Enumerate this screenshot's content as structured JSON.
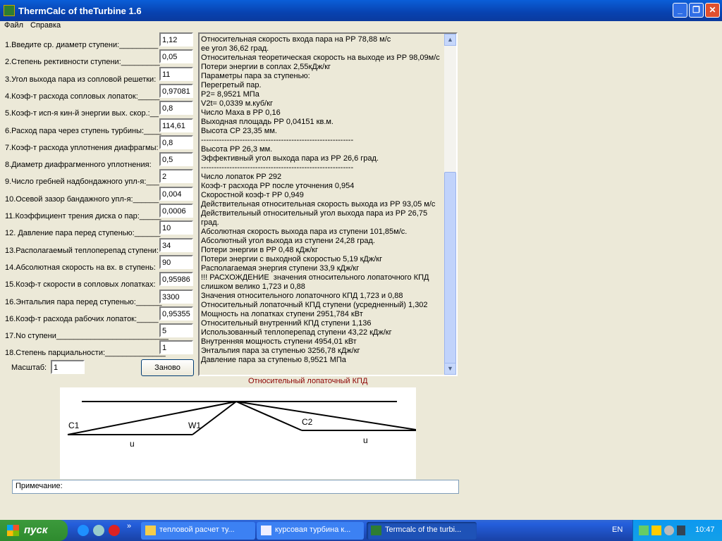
{
  "window": {
    "title": "ThermCalc of theTurbine 1.6",
    "minimize": "_",
    "maximize": "❐",
    "close": "✕"
  },
  "menu": [
    "Файл",
    "Справка"
  ],
  "fields": [
    {
      "label": "1.Введите ср. диаметр ступени:_________",
      "value": "1,12"
    },
    {
      "label": "2.Степень рективности ступени:_________",
      "value": "0,05"
    },
    {
      "label": "3.Угол выхода пара из сопловой решетки:",
      "value": "11"
    },
    {
      "label": "4.Коэф-т расхода сопловых лопаток:_____",
      "value": "0,97081"
    },
    {
      "label": "5.Коэф-т исп-я кин-й энергии вых. скор.:__",
      "value": "0,8"
    },
    {
      "label": "6.Расход пара через ступень турбины:____",
      "value": "114,61"
    },
    {
      "label": "7.Коэф-т расхода уплотнения диафрагмы:",
      "value": "0,8"
    },
    {
      "label": "8.Диаметр диафрагменного уплотнения:",
      "value": "0,5"
    },
    {
      "label": "9.Число гребней надбондажного упл-я:___",
      "value": "2"
    },
    {
      "label": "10.Осевой зазор бандажного упл-я:______",
      "value": "0,004"
    },
    {
      "label": "11.Коэффициент трения диска о пар:_____",
      "value": "0,0006"
    },
    {
      "label": "12. Давление пара перед ступенью:______",
      "value": "10"
    },
    {
      "label": "13.Располагаемый теплоперепад ступени:",
      "value": "34"
    },
    {
      "label": "14.Абсолютная скорость на вх. в ступень:",
      "value": "90"
    },
    {
      "label": "15.Коэф-т скорости в сопловых лопатках:",
      "value": "0,95986"
    },
    {
      "label": "16.Энтальпия пара перед ступенью:______",
      "value": "3300"
    },
    {
      "label": "16.Коэф-т расхода рабочих лопаток:_____",
      "value": "0,95355"
    },
    {
      "label": "17.No ступени__________________________",
      "value": "5"
    },
    {
      "label": "18.Степень парциальности:______________",
      "value": "1"
    }
  ],
  "scale": {
    "label": "Масштаб:",
    "value": "1"
  },
  "reset_button": "Заново",
  "output_lines": [
    "Относительная скорость входа пара на РР 78,88 м/с",
    "ее угол 36,62 град.",
    "Относительная теоретическая скорость на выходе из РР 98,09м/с",
    "Потери энергии в соплах 2,55кДж/кг",
    "Параметры пара за ступенью:",
    "Перегретый пар.",
    "P2= 8,9521 МПа",
    "V2t= 0,0339 м.куб/кг",
    "Число Маха в РР 0,16",
    "Выходная площадь РР 0,04151 кв.м.",
    "Высота СР 23,35 мм.",
    "-----------------------------------------------------------",
    "Высота РР 26,3 мм.",
    "Эффективный угол выхода пара из РР 26,6 град.",
    "-----------------------------------------------------------",
    "Число лопаток РР 292",
    "Коэф-т расхода РР после уточнения 0,954",
    "Скоростной коэф-т РР 0,949",
    "Действительная относительная скорость выхода из РР 93,05 м/с",
    "Действительный относительный угол выхода пара из РР 26,75 град.",
    "Абсолютная скорость выхода пара из ступени 101,85м/с.",
    "Абсолютный угол выхода из ступени 24,28 град.",
    "Потери энергии в РР 0,48 кДж/кг",
    "Потери энергии с выходной скоростью 5,19 кДж/кг",
    "Располагаемая энергия ступени 33,9 кДж/кг",
    "!!! РАСХОЖДЕНИЕ  значения относительного лопаточного КПД слишком велико 1,723 и 0,88",
    "Значения относительного лопаточного КПД 1,723 и 0,88",
    "Относительный лопаточный КПД ступени (усредненный) 1,302",
    "Мощность на лопатках ступени 2951,784 кВт",
    "Относительный внутренний КПД ступени 1,136",
    "Использованный теплоперепад ступени 43,22 кДж/кг",
    "Внутренняя мощность ступени 4954,01 кВт",
    "Энтальпия пара за ступенью 3256,78 кДж/кг",
    "Давление пара за ступенью 8,9521 МПа"
  ],
  "diagram": {
    "caption": "Относительный лопаточный КПД",
    "labels": {
      "c1": "C1",
      "w1": "W1",
      "c2": "C2",
      "u1": "u",
      "u2": "u"
    }
  },
  "note_label": "Примечание:",
  "taskbar": {
    "start": "пуск",
    "tasks": [
      "тепловой расчет ту...",
      "курсовая турбина к...",
      "Termcalc of the turbi..."
    ],
    "lang": "EN",
    "clock": "10:47",
    "chevron": "»"
  }
}
